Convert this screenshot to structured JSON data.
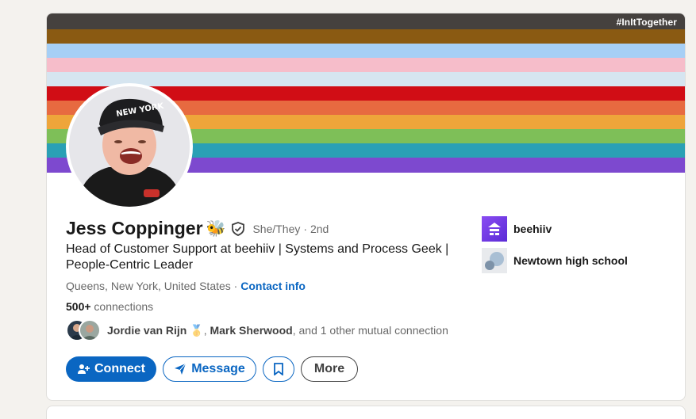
{
  "banner": {
    "hashtag": "#InItTogether",
    "colors": [
      "#45413e",
      "#8a5a12",
      "#a6cff5",
      "#f6bdca",
      "#d6e5f0",
      "#d10d15",
      "#e76a40",
      "#eea53a",
      "#7ebf58",
      "#2aa0b5",
      "#7d49cf"
    ]
  },
  "profile": {
    "name": "Jess Coppinger",
    "name_emoji": "🐝",
    "pronouns": "She/They",
    "degree": "· 2nd",
    "headline": "Head of Customer Support at beehiiv | Systems and Process Geek | People-Centric Leader",
    "location": "Queens, New York, United States",
    "separator": " · ",
    "contact_label": "Contact info",
    "connections_count": "500+",
    "connections_label": " connections"
  },
  "mutual": {
    "name1": "Jordie van Rijn",
    "name1_emoji": "🥇",
    "comma": ", ",
    "name2": "Mark Sherwood",
    "rest": ", and 1 other mutual connection"
  },
  "actions": {
    "connect": "Connect",
    "message": "Message",
    "more": "More"
  },
  "side": {
    "company": "beehiiv",
    "school": "Newtown high school"
  },
  "icons": {
    "verify": "shield-check-icon",
    "connect": "add-person-icon",
    "message": "paper-plane-icon",
    "save": "bookmark-icon",
    "company_logo": "beehiiv-logo",
    "school_logo": "school-logo"
  }
}
